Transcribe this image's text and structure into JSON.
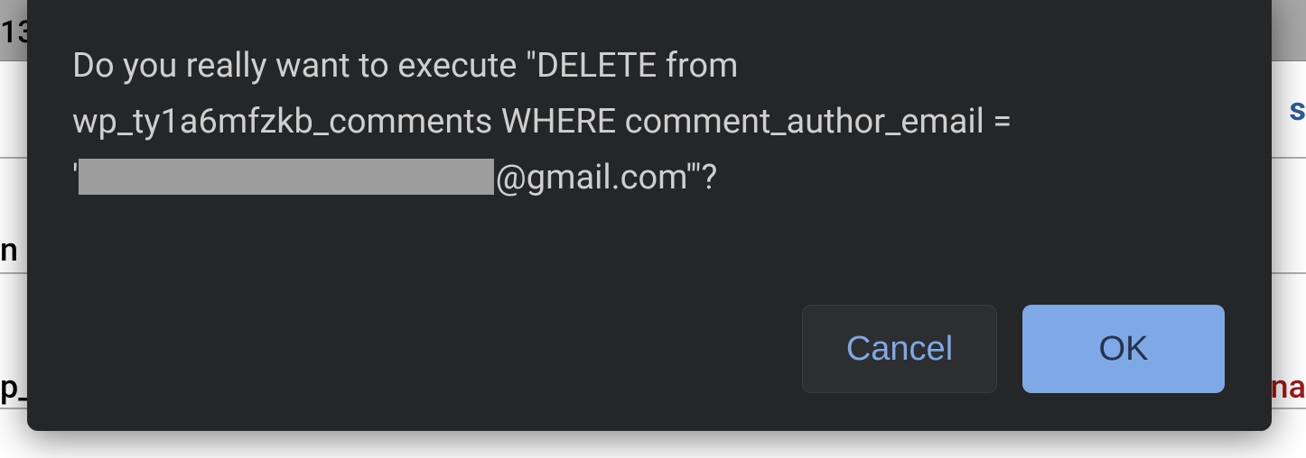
{
  "background": {
    "top_number": "13",
    "right_s": "s",
    "left_n": "n",
    "left_p": "p_",
    "right_na": "na"
  },
  "dialog": {
    "message_line1": "Do you really want to execute \"DELETE from",
    "message_line2": "wp_ty1a6mfzkb_comments WHERE comment_author_email =",
    "message_line3_prefix": "'",
    "message_line3_suffix_email": "@gmail.com'\"?",
    "buttons": {
      "cancel": "Cancel",
      "ok": "OK"
    }
  }
}
